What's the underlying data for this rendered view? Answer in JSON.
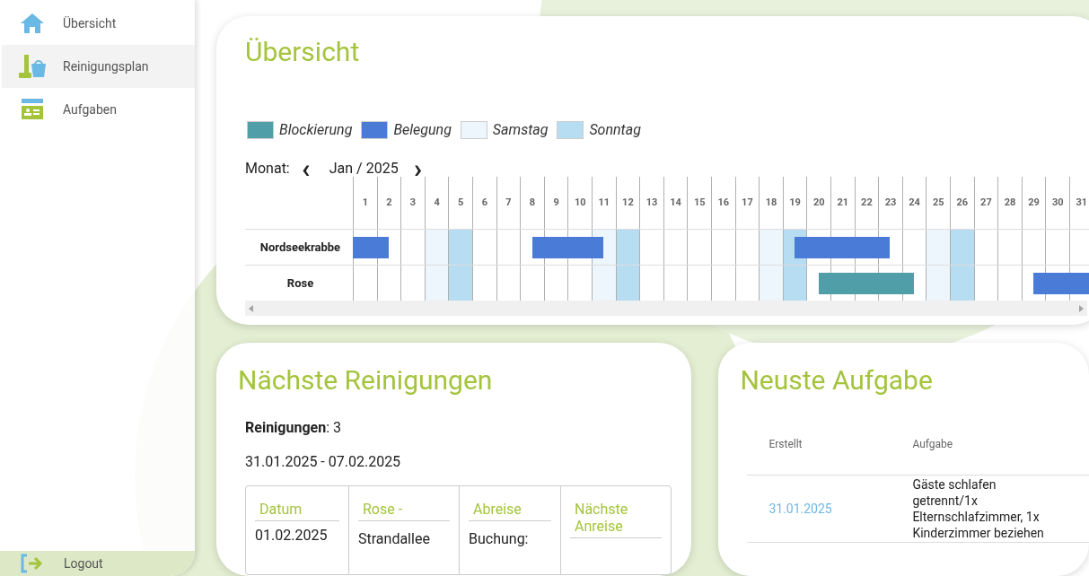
{
  "sidebar": {
    "items": [
      {
        "label": "Übersicht",
        "selected": false
      },
      {
        "label": "Reinigungsplan",
        "selected": true
      },
      {
        "label": "Aufgaben",
        "selected": false
      }
    ],
    "logout": {
      "label": "Logout"
    }
  },
  "overview": {
    "title": "Übersicht",
    "legend": [
      {
        "label": "Blockierung",
        "color": "#509fa8"
      },
      {
        "label": "Belegung",
        "color": "#4a7bd6"
      },
      {
        "label": "Samstag",
        "color": "#eef6fd"
      },
      {
        "label": "Sonntag",
        "color": "#b7ddf2"
      }
    ],
    "month_label": "Monat:",
    "month": "Jan / 2025",
    "prev": "‹",
    "next": "›",
    "days": [
      {
        "label": "1",
        "kind": "weekday"
      },
      {
        "label": "2",
        "kind": "weekday"
      },
      {
        "label": "3",
        "kind": "weekday"
      },
      {
        "label": "4",
        "kind": "saturday"
      },
      {
        "label": "5",
        "kind": "sunday"
      },
      {
        "label": "6",
        "kind": "weekday"
      },
      {
        "label": "7",
        "kind": "weekday"
      },
      {
        "label": "8",
        "kind": "weekday"
      },
      {
        "label": "9",
        "kind": "weekday"
      },
      {
        "label": "10",
        "kind": "weekday"
      },
      {
        "label": "11",
        "kind": "saturday"
      },
      {
        "label": "12",
        "kind": "sunday"
      },
      {
        "label": "13",
        "kind": "weekday"
      },
      {
        "label": "14",
        "kind": "weekday"
      },
      {
        "label": "15",
        "kind": "weekday"
      },
      {
        "label": "16",
        "kind": "weekday"
      },
      {
        "label": "17",
        "kind": "weekday"
      },
      {
        "label": "18",
        "kind": "saturday"
      },
      {
        "label": "19",
        "kind": "sunday"
      },
      {
        "label": "20",
        "kind": "weekday"
      },
      {
        "label": "21",
        "kind": "weekday"
      },
      {
        "label": "22",
        "kind": "weekday"
      },
      {
        "label": "23",
        "kind": "weekday"
      },
      {
        "label": "24",
        "kind": "weekday"
      },
      {
        "label": "25",
        "kind": "saturday"
      },
      {
        "label": "26",
        "kind": "sunday"
      },
      {
        "label": "27",
        "kind": "weekday"
      },
      {
        "label": "28",
        "kind": "weekday"
      },
      {
        "label": "29",
        "kind": "weekday"
      },
      {
        "label": "30",
        "kind": "weekday"
      },
      {
        "label": "31",
        "kind": "weekday"
      }
    ],
    "rows": [
      {
        "name": "Nordseekrabbe",
        "bars": [
          {
            "kind": "belegung"
          },
          {
            "kind": "belegung"
          },
          {
            "kind": "belegung"
          }
        ]
      },
      {
        "name": "Rose",
        "bars": [
          {
            "kind": "blockierung"
          },
          {
            "kind": "belegung"
          }
        ]
      }
    ]
  },
  "next_cleanings": {
    "title": "Nächste Reinigungen",
    "count_text": "**Reinigungen**: 3",
    "range": "31.01.2025 - 07.02.2025",
    "columns": [
      [
        "Datum"
      ],
      [
        "Rose -"
      ],
      [
        "Abreise"
      ],
      [
        "Nächste",
        "Anreise"
      ]
    ],
    "cells": [
      "01.02.2025",
      "Strandallee",
      "Buchung:"
    ]
  },
  "latest_task": {
    "title": "Neuste Aufgabe",
    "columns": [
      "Erstellt",
      "Aufgabe"
    ],
    "rows": [
      {
        "created": "31.01.2025",
        "task": "Gäste schlafen getrennt/1x Elternschlafzimmer, 1x Kinderzimmer beziehen"
      }
    ]
  }
}
